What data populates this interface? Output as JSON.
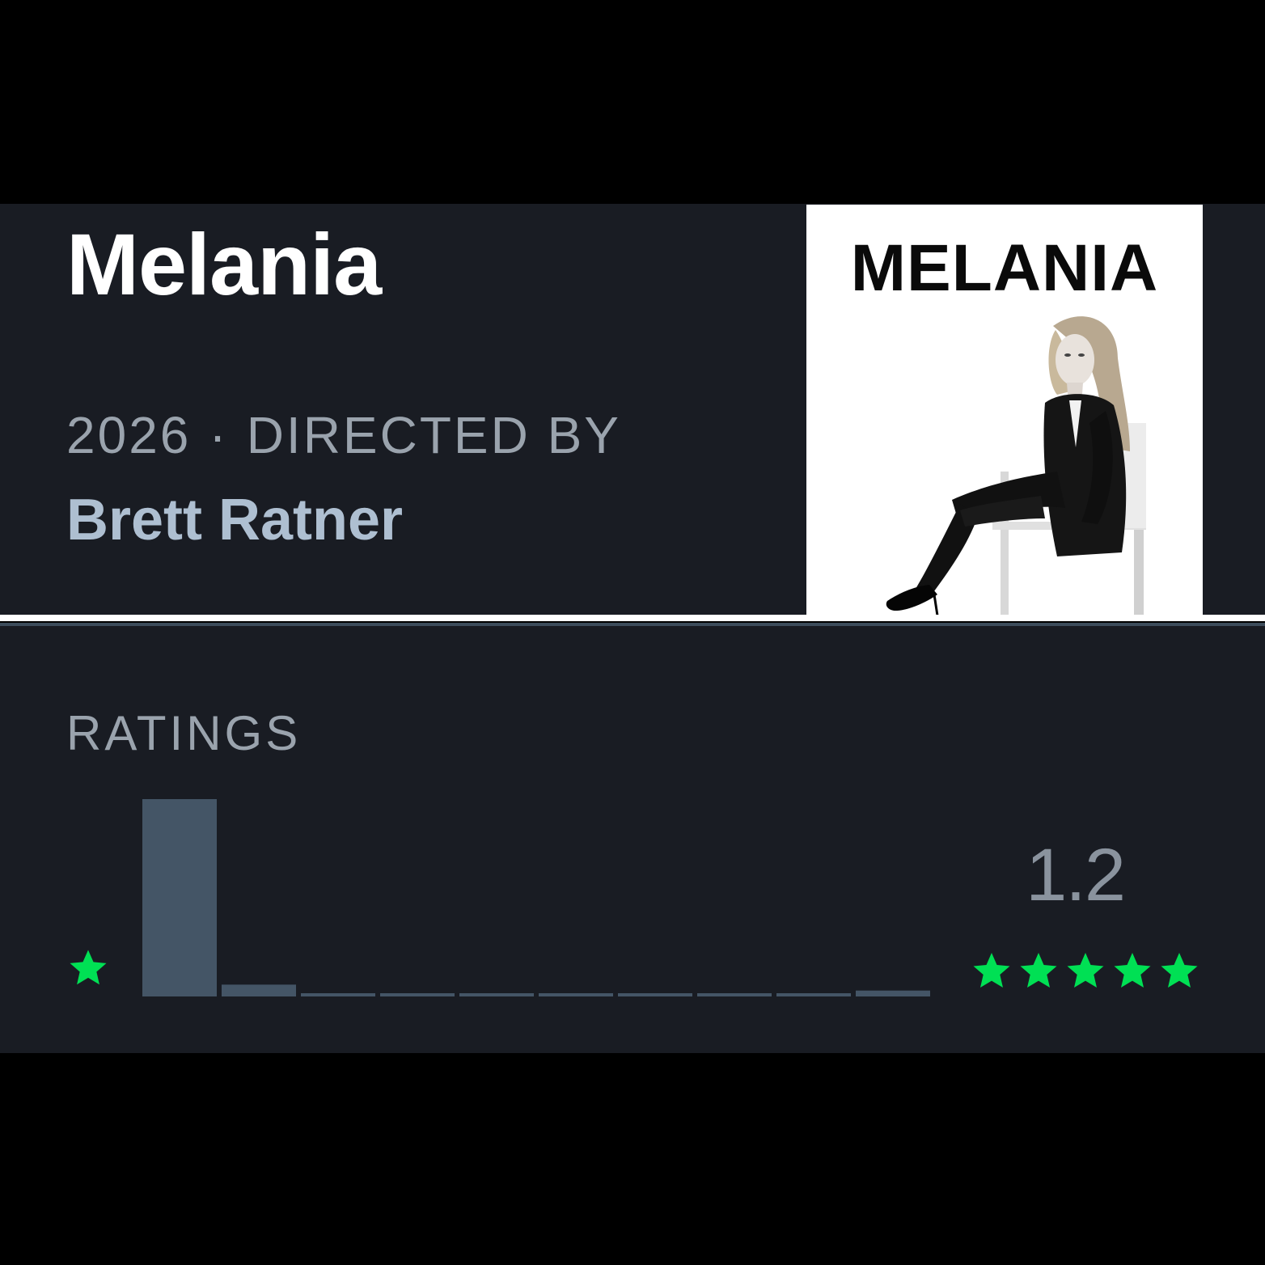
{
  "film": {
    "title": "Melania",
    "year": "2026",
    "separator": "·",
    "directed_by_label": "DIRECTED BY",
    "director": "Brett Ratner"
  },
  "poster": {
    "title": "MELANIA"
  },
  "ratings": {
    "heading": "RATINGS",
    "average": "1.2",
    "low_star_icon": "star-icon",
    "high_stars_icon": "five-stars-icon",
    "star_color": "#00e054",
    "bar_color": "#456"
  },
  "chart_data": {
    "type": "bar",
    "categories": [
      "0.5",
      "1",
      "1.5",
      "2",
      "2.5",
      "3",
      "3.5",
      "4",
      "4.5",
      "5"
    ],
    "values": [
      100,
      6,
      0.5,
      0.5,
      0.5,
      0.5,
      0.5,
      0.5,
      0.5,
      3
    ],
    "title": "",
    "xlabel": "",
    "ylabel": "",
    "ylim": [
      0,
      100
    ]
  }
}
